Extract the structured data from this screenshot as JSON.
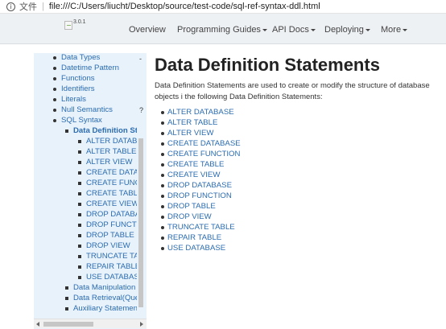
{
  "browser": {
    "scheme_label": "文件",
    "url": "file:///C:/Users/liucht/Desktop/source/test-code/sql-ref-syntax-ddl.html"
  },
  "navbar": {
    "version": "3.0.1",
    "items": [
      {
        "label": "Overview",
        "has_dropdown": false
      },
      {
        "label": "Programming Guides",
        "has_dropdown": true
      },
      {
        "label": "API Docs",
        "has_dropdown": true
      },
      {
        "label": "Deploying",
        "has_dropdown": true
      },
      {
        "label": "More",
        "has_dropdown": true
      }
    ]
  },
  "sidebar": {
    "items": [
      {
        "label": "Data Types",
        "level": 1
      },
      {
        "label": "Datetime Pattern",
        "level": 1
      },
      {
        "label": "Functions",
        "level": 1
      },
      {
        "label": "Identifiers",
        "level": 1
      },
      {
        "label": "Literals",
        "level": 1
      },
      {
        "label": "Null Semantics",
        "level": 1
      },
      {
        "label": "SQL Syntax",
        "level": 1
      },
      {
        "label": "Data Definition St",
        "level": 2,
        "active": true
      },
      {
        "label": "ALTER DATAB",
        "level": 3
      },
      {
        "label": "ALTER TABLE",
        "level": 3
      },
      {
        "label": "ALTER VIEW",
        "level": 3
      },
      {
        "label": "CREATE DATA",
        "level": 3
      },
      {
        "label": "CREATE FUNC",
        "level": 3
      },
      {
        "label": "CREATE TABL",
        "level": 3
      },
      {
        "label": "CREATE VIEW",
        "level": 3
      },
      {
        "label": "DROP DATABA",
        "level": 3
      },
      {
        "label": "DROP FUNCT",
        "level": 3
      },
      {
        "label": "DROP TABLE",
        "level": 3
      },
      {
        "label": "DROP VIEW",
        "level": 3
      },
      {
        "label": "TRUNCATE TA",
        "level": 3
      },
      {
        "label": "REPAIR TABLE",
        "level": 3
      },
      {
        "label": "USE DATABAS",
        "level": 3
      },
      {
        "label": "Data Manipulation",
        "level": 2
      },
      {
        "label": "Data Retrieval(Que",
        "level": 2
      },
      {
        "label": "Auxiliary Statemen",
        "level": 2
      }
    ],
    "scroll_marks": [
      "-",
      "?"
    ]
  },
  "main": {
    "title": "Data Definition Statements",
    "intro": "Data Definition Statements are used to create or modify the structure of database objects i the following Data Definition Statements:",
    "statements": [
      "ALTER DATABASE",
      "ALTER TABLE",
      "ALTER VIEW",
      "CREATE DATABASE",
      "CREATE FUNCTION",
      "CREATE TABLE",
      "CREATE VIEW",
      "DROP DATABASE",
      "DROP FUNCTION",
      "DROP TABLE",
      "DROP VIEW",
      "TRUNCATE TABLE",
      "REPAIR TABLE",
      "USE DATABASE"
    ]
  },
  "colors": {
    "link": "#2b6cb0",
    "navbar_bg": "#eef1f4",
    "sidebar_bg": "#e8f2fb"
  }
}
